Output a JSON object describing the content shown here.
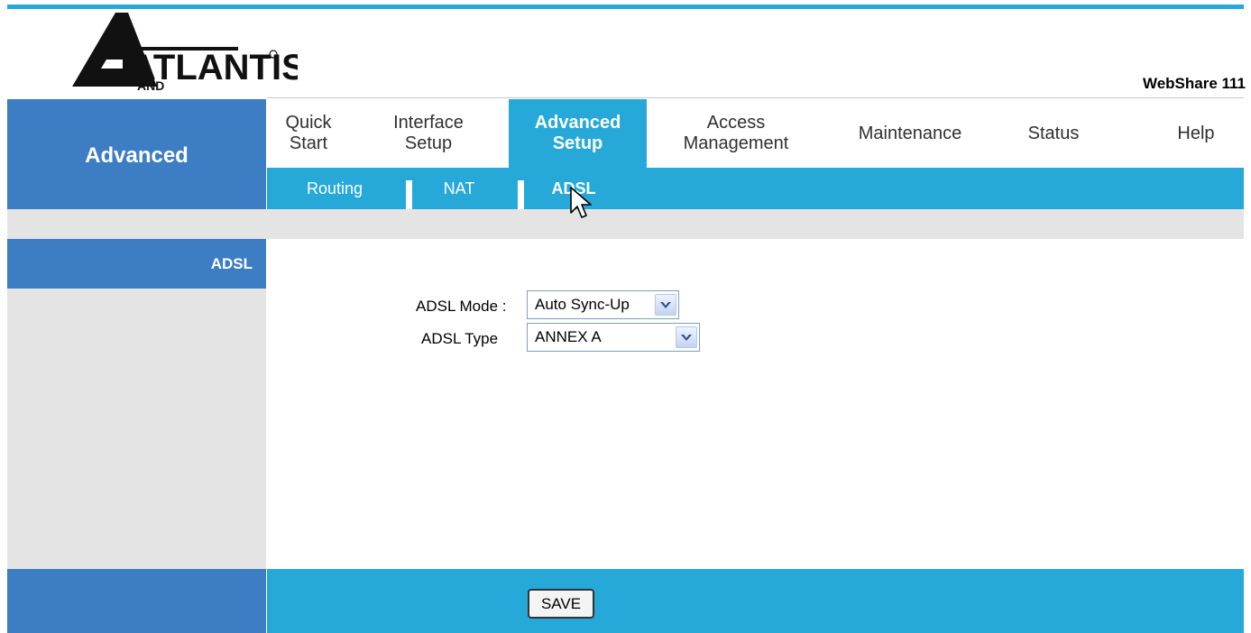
{
  "brand": {
    "logo_text": "ATLANTIS",
    "logo_subtext": "AND",
    "model": "WebShare 111"
  },
  "section_title": "Advanced",
  "main_tabs": [
    {
      "label": "Quick\nStart"
    },
    {
      "label": "Interface\nSetup"
    },
    {
      "label": "Advanced\nSetup",
      "active": true
    },
    {
      "label": "Access\nManagement"
    },
    {
      "label": "Maintenance"
    },
    {
      "label": "Status"
    },
    {
      "label": "Help"
    }
  ],
  "sub_tabs": [
    {
      "label": "Routing"
    },
    {
      "label": "NAT"
    },
    {
      "label": "ADSL",
      "active": true
    }
  ],
  "sidebar": {
    "active_item": "ADSL"
  },
  "form": {
    "adsl_mode": {
      "label": "ADSL Mode :",
      "value": "Auto Sync-Up"
    },
    "adsl_type": {
      "label": "ADSL Type",
      "value": "ANNEX A"
    }
  },
  "footer": {
    "save_label": "SAVE"
  },
  "colors": {
    "accent": "#26a9d9",
    "title_blue": "#3d7dc3",
    "panel_gray": "#e4e4e4"
  }
}
